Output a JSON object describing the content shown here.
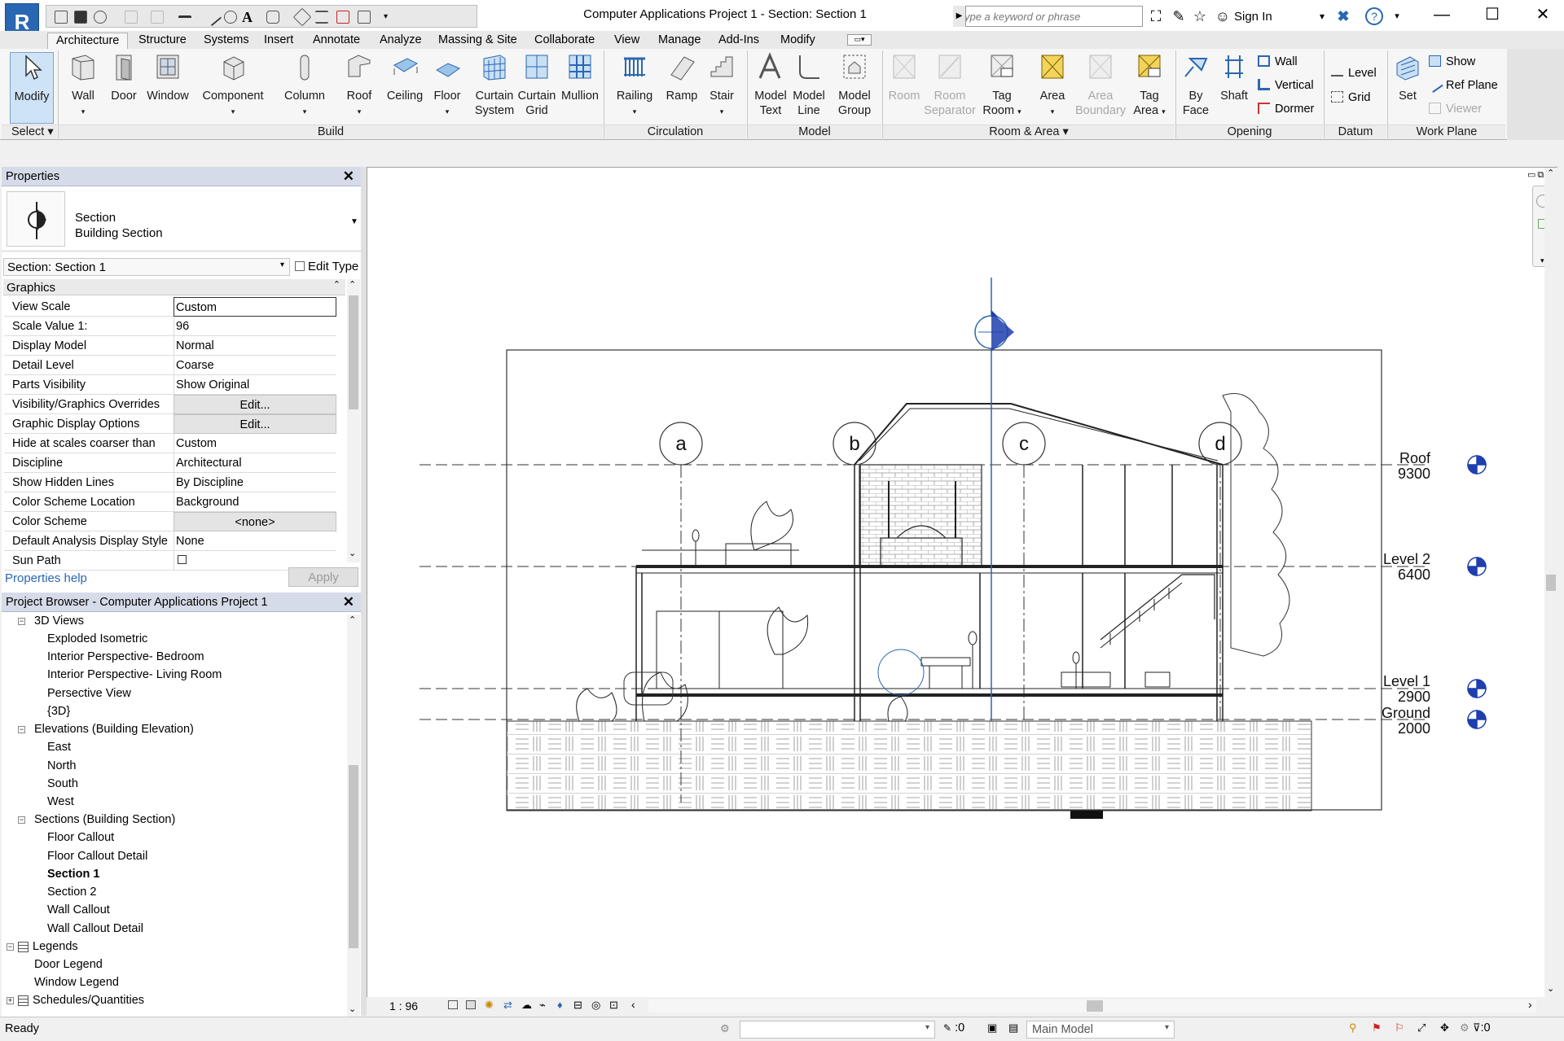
{
  "app": {
    "logo_letter": "R",
    "title": "Computer Applications Project 1 - Section: Section 1",
    "search_placeholder": "Type a keyword or phrase",
    "sign_in": "Sign In"
  },
  "tabs": [
    "Architecture",
    "Structure",
    "Systems",
    "Insert",
    "Annotate",
    "Analyze",
    "Massing & Site",
    "Collaborate",
    "View",
    "Manage",
    "Add-Ins",
    "Modify"
  ],
  "active_tab": "Architecture",
  "ribbon": {
    "select": {
      "modify": "Modify",
      "select_label": "Select"
    },
    "build": {
      "label": "Build",
      "wall": "Wall",
      "door": "Door",
      "window": "Window",
      "component": "Component",
      "column": "Column",
      "roof": "Roof",
      "ceiling": "Ceiling",
      "floor": "Floor",
      "curtain_system_1": "Curtain",
      "curtain_system_2": "System",
      "curtain_grid_1": "Curtain",
      "curtain_grid_2": "Grid",
      "mullion": "Mullion"
    },
    "circulation": {
      "label": "Circulation",
      "railing": "Railing",
      "ramp": "Ramp",
      "stair": "Stair"
    },
    "model": {
      "label": "Model",
      "model_text_1": "Model",
      "model_text_2": "Text",
      "model_line_1": "Model",
      "model_line_2": "Line",
      "model_group_1": "Model",
      "model_group_2": "Group"
    },
    "room_area": {
      "label": "Room & Area",
      "room": "Room",
      "room_sep_1": "Room",
      "room_sep_2": "Separator",
      "tag_room_1": "Tag",
      "tag_room_2": "Room",
      "area": "Area",
      "area_boundary_1": "Area",
      "area_boundary_2": "Boundary",
      "tag_area_1": "Tag",
      "tag_area_2": "Area"
    },
    "opening": {
      "label": "Opening",
      "by_face_1": "By",
      "by_face_2": "Face",
      "shaft": "Shaft",
      "wall": "Wall",
      "vertical": "Vertical",
      "dormer": "Dormer"
    },
    "datum": {
      "label": "Datum",
      "level": "Level",
      "grid": "Grid"
    },
    "work_plane": {
      "label": "Work Plane",
      "set": "Set",
      "show": "Show",
      "ref_plane": "Ref  Plane",
      "viewer": "Viewer"
    }
  },
  "properties": {
    "header": "Properties",
    "type_line1": "Section",
    "type_line2": "Building Section",
    "selector": "Section: Section 1",
    "edit_type": "Edit Type",
    "group": "Graphics",
    "rows": [
      {
        "k": "View Scale",
        "v": "Custom"
      },
      {
        "k": "Scale Value    1:",
        "v": "96"
      },
      {
        "k": "Display Model",
        "v": "Normal"
      },
      {
        "k": "Detail Level",
        "v": "Coarse"
      },
      {
        "k": "Parts Visibility",
        "v": "Show Original"
      },
      {
        "k": "Visibility/Graphics Overrides",
        "v": "Edit..."
      },
      {
        "k": "Graphic Display Options",
        "v": "Edit..."
      },
      {
        "k": "Hide at scales coarser than",
        "v": "Custom"
      },
      {
        "k": "Discipline",
        "v": "Architectural"
      },
      {
        "k": "Show Hidden Lines",
        "v": "By Discipline"
      },
      {
        "k": "Color Scheme Location",
        "v": "Background"
      },
      {
        "k": "Color Scheme",
        "v": "<none>"
      },
      {
        "k": "Default Analysis Display Style",
        "v": "None"
      },
      {
        "k": "Sun Path",
        "v": ""
      }
    ],
    "help": "Properties help",
    "apply": "Apply"
  },
  "browser": {
    "header": "Project Browser - Computer Applications Project 1",
    "items": [
      {
        "t": "3D Views"
      },
      {
        "t": "Exploded Isometric"
      },
      {
        "t": "Interior Perspective- Bedroom"
      },
      {
        "t": "Interior Perspective- Living Room"
      },
      {
        "t": "Persective View"
      },
      {
        "t": "{3D}"
      },
      {
        "t": "Elevations (Building Elevation)"
      },
      {
        "t": "East"
      },
      {
        "t": "North"
      },
      {
        "t": "South"
      },
      {
        "t": "West"
      },
      {
        "t": "Sections (Building Section)"
      },
      {
        "t": "Floor Callout"
      },
      {
        "t": "Floor Callout Detail"
      },
      {
        "t": "Section 1"
      },
      {
        "t": "Section 2"
      },
      {
        "t": "Wall Callout"
      },
      {
        "t": "Wall Callout Detail"
      },
      {
        "t": "Legends"
      },
      {
        "t": "Door Legend"
      },
      {
        "t": "Window Legend"
      },
      {
        "t": "Schedules/Quantities"
      }
    ]
  },
  "drawing": {
    "grids": [
      "a",
      "b",
      "c",
      "d"
    ],
    "levels": [
      {
        "name": "Roof",
        "elev": "9300"
      },
      {
        "name": "Level 2",
        "elev": "6400"
      },
      {
        "name": "Level 1",
        "elev": "2900"
      },
      {
        "name": "Ground",
        "elev": "2000"
      }
    ]
  },
  "view_bar": {
    "scale": "1 : 96"
  },
  "status": {
    "text": "Ready",
    "worksets": ":0",
    "model": "Main Model",
    "filter": ":0"
  }
}
